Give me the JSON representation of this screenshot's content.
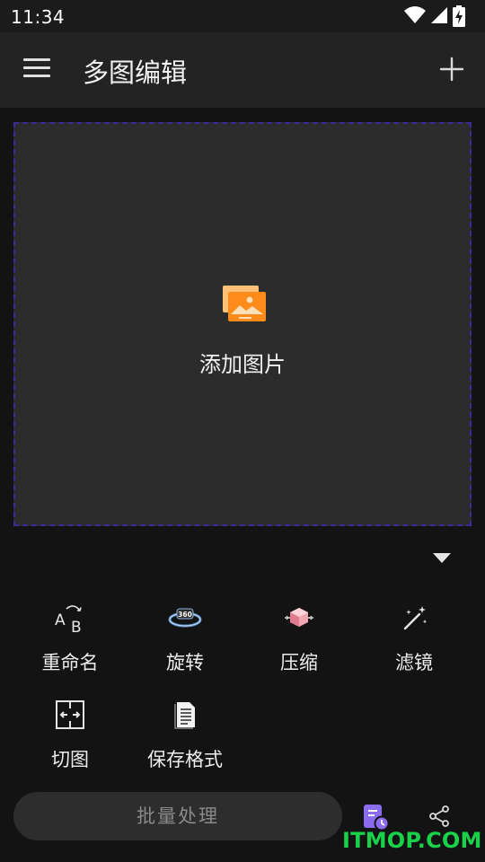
{
  "status_bar": {
    "time": "11:34"
  },
  "app_bar": {
    "title": "多图编辑"
  },
  "drop_zone": {
    "label": "添加图片"
  },
  "tools": [
    {
      "label": "重命名",
      "icon": "rename-icon"
    },
    {
      "label": "旋转",
      "icon": "rotate-360-icon"
    },
    {
      "label": "压缩",
      "icon": "compress-icon"
    },
    {
      "label": "滤镜",
      "icon": "magic-wand-icon"
    },
    {
      "label": "切图",
      "icon": "crop-split-icon"
    },
    {
      "label": "保存格式",
      "icon": "document-format-icon"
    }
  ],
  "bottom_bar": {
    "batch_label": "批量处理"
  },
  "watermark": "ITMOP.COM",
  "colors": {
    "accent_purple": "#8b6cf0",
    "gallery_orange": "#ff8c1a",
    "watermark_green": "#19d24a",
    "dashed_border": "#3b2a9a"
  }
}
